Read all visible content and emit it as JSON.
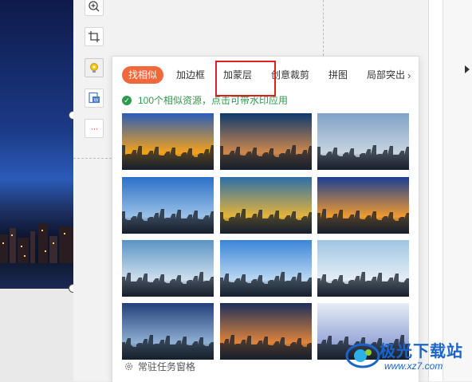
{
  "suggestion_panel": {
    "tabs": [
      {
        "label": "找相似",
        "active": true
      },
      {
        "label": "加边框",
        "active": false
      },
      {
        "label": "加蒙层",
        "active": false
      },
      {
        "label": "创意裁剪",
        "active": false
      },
      {
        "label": "拼图",
        "active": false
      },
      {
        "label": "局部突出",
        "active": false
      }
    ],
    "tab_next": "›",
    "notice": "100个相似资源，点击可带水印应用",
    "footer_label": "常驻任务窗格",
    "thumbnails": [
      {
        "desc": "sunset skyline",
        "c1": "#2a5db8",
        "c2": "#f5a21a"
      },
      {
        "desc": "dusk skyline",
        "c1": "#0d3a6e",
        "c2": "#d0884a"
      },
      {
        "desc": "cloudy skyline",
        "c1": "#7fa2c8",
        "c2": "#c8d4e0"
      },
      {
        "desc": "blue sky city",
        "c1": "#2b70c8",
        "c2": "#9bc1e6"
      },
      {
        "desc": "golden city",
        "c1": "#2c6fa8",
        "c2": "#e6b43a"
      },
      {
        "desc": "orange sunset",
        "c1": "#1a3e94",
        "c2": "#f29a2e"
      },
      {
        "desc": "light blue city",
        "c1": "#5b93c4",
        "c2": "#cfe0ee"
      },
      {
        "desc": "wispy clouds",
        "c1": "#3a85d8",
        "c2": "#bcd8f2"
      },
      {
        "desc": "hazy skyline",
        "c1": "#9fc5e2",
        "c2": "#e4eef6"
      },
      {
        "desc": "evening city",
        "c1": "#243f7a",
        "c2": "#8fb0d4"
      },
      {
        "desc": "sunset tower",
        "c1": "#1c2f5c",
        "c2": "#e0843a"
      },
      {
        "desc": "pale sky",
        "c1": "#e6ecf6",
        "c2": "#98a8d8"
      }
    ]
  },
  "toolbar": {
    "zoom_icon": "zoom-in-icon",
    "crop_icon": "crop-icon",
    "idea_icon": "lightbulb-icon",
    "word_icon": "word-doc-icon",
    "more_label": "···"
  },
  "watermark": {
    "brand": "极光下载站",
    "url": "www.xz7.com"
  }
}
